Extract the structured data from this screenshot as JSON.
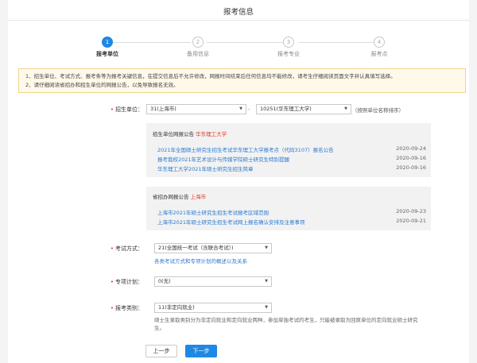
{
  "header": {
    "title": "报考信息"
  },
  "steps": [
    {
      "number": "1",
      "label": "报考单位"
    },
    {
      "number": "2",
      "label": "备用信息"
    },
    {
      "number": "3",
      "label": "报考专业"
    },
    {
      "number": "4",
      "label": "报考点"
    }
  ],
  "notice": {
    "line1": "1、招生单位、考试方式、报考条等为报考关键信息，在提交信息后不允许修改，网报时间结束后任何信息均不能修改，请考生仔细阅读页面文字并认真填写选择。",
    "line2": "2、请仔细阅读省招办和招生单位的网报公告，以免导致报名无效。"
  },
  "form": {
    "unit": {
      "label": "招生单位：",
      "province_value": "31(上海市)",
      "separator": "-",
      "school_value": "10251(华东理工大学)",
      "sort_note": "（按照单位名称排序）"
    },
    "school_notice": {
      "title": "招生单位网报公告",
      "school_name": "华东理工大学",
      "items": [
        {
          "text": "2021年全国硕士研究生招生考试华东理工大学报考点（代码3107）报名公告",
          "date": "2020-09-24"
        },
        {
          "text": "报考我校2021年艺术设计与传媒学院硕士研究生特别提醒",
          "date": "2020-09-16"
        },
        {
          "text": "华东理工大学2021年硕士研究生招生简章",
          "date": "2020-09-16"
        }
      ]
    },
    "province_notice": {
      "title": "省招办网报公告",
      "province_name": "上海市",
      "items": [
        {
          "text": "上海市2021年硕士研究生招生考试报考区域范围",
          "date": "2020-09-23"
        },
        {
          "text": "上海市2021年硕士研究生招生考试网上报名确认安排及注意事项",
          "date": "2020-09-21"
        }
      ]
    },
    "exam_method": {
      "label": "考试方式：",
      "value": "21(全国统一考试（含联合考试）)",
      "link": "各类考试方式和专项计划的概述以及关系"
    },
    "special_plan": {
      "label": "专项计划：",
      "value": "0(无)"
    },
    "category": {
      "label": "报考类别：",
      "value": "11(非定向就业)",
      "hint_line1": "硕士生录取类别分为非定向就业和定向就业两种，参加单独考试的考生，只能被录取为回原单位的定向就业硕士研究",
      "hint_line2": "生。"
    }
  },
  "buttons": {
    "prev": "上一步",
    "next": "下一步"
  },
  "colors": {
    "accent": "#1e88e5",
    "link": "#2a7ad2",
    "required": "#e0382b",
    "notice_bg": "#fff9ea"
  }
}
